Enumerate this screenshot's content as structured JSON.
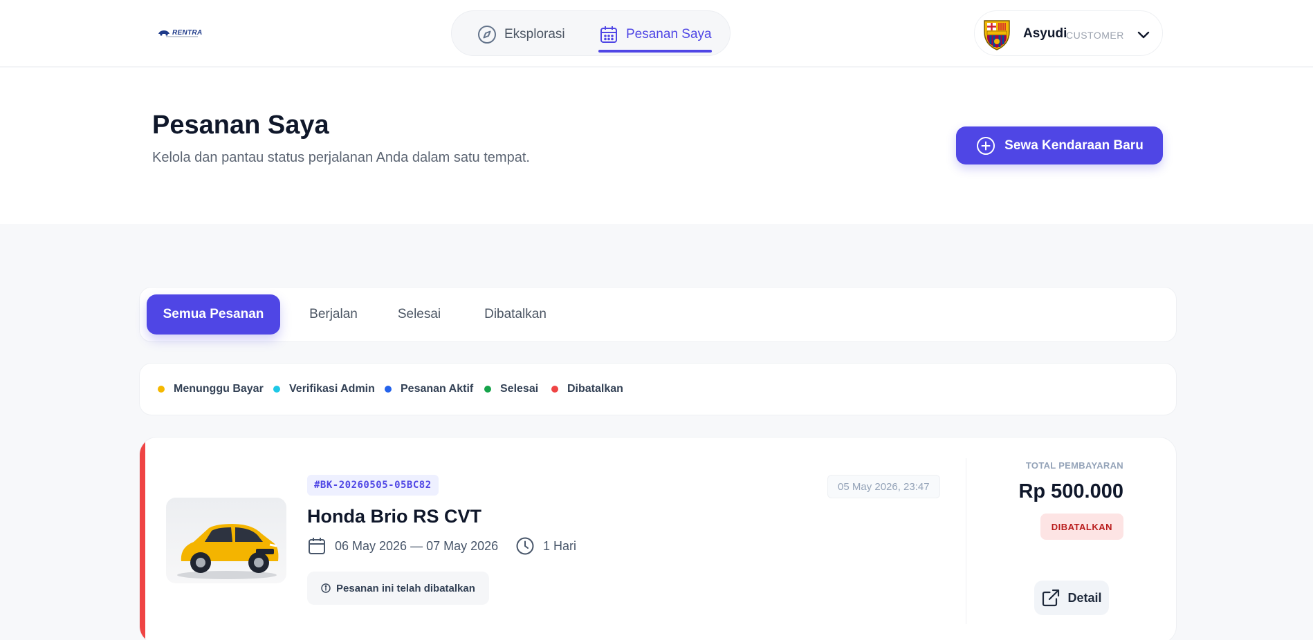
{
  "header": {
    "logo_text": "RENTRA",
    "nav": [
      {
        "label": "Eksplorasi",
        "icon": "compass-icon"
      },
      {
        "label": "Pesanan Saya",
        "icon": "calendar-icon",
        "active": true
      }
    ],
    "user": {
      "name": "Asyudi",
      "role": "CUSTOMER",
      "avatar": "fc-barcelona-crest"
    }
  },
  "hero": {
    "title": "Pesanan Saya",
    "subtitle": "Kelola dan pantau status perjalanan Anda dalam satu tempat.",
    "new_button_label": "Sewa Kendaraan Baru"
  },
  "tabs": [
    {
      "label": "Semua Pesanan",
      "active": true
    },
    {
      "label": "Berjalan",
      "active": false
    },
    {
      "label": "Selesai",
      "active": false
    },
    {
      "label": "Dibatalkan",
      "active": false
    }
  ],
  "legend": [
    {
      "label": "Menunggu Bayar",
      "color": "#f5b800"
    },
    {
      "label": "Verifikasi Admin",
      "color": "#1ec8e6"
    },
    {
      "label": "Pesanan Aktif",
      "color": "#2563eb"
    },
    {
      "label": "Selesai",
      "color": "#16a34a"
    },
    {
      "label": "Dibatalkan",
      "color": "#ef4444"
    }
  ],
  "bookings": [
    {
      "code": "#BK-20260505-05BC82",
      "car_name": "Honda Brio RS CVT",
      "date_range": "06 May 2026 — 07 May 2026",
      "duration": "1 Hari",
      "note": "Pesanan ini telah dibatalkan",
      "order_date": "05 May 2026, 23:47",
      "total_label": "TOTAL PEMBAYARAN",
      "total_amount": "Rp 500.000",
      "status": "DIBATALKAN",
      "detail_label": "Detail",
      "accent_color": "#ef4444"
    }
  ],
  "colors": {
    "primary": "#4f46e5",
    "cancelled": "#ef4444"
  }
}
